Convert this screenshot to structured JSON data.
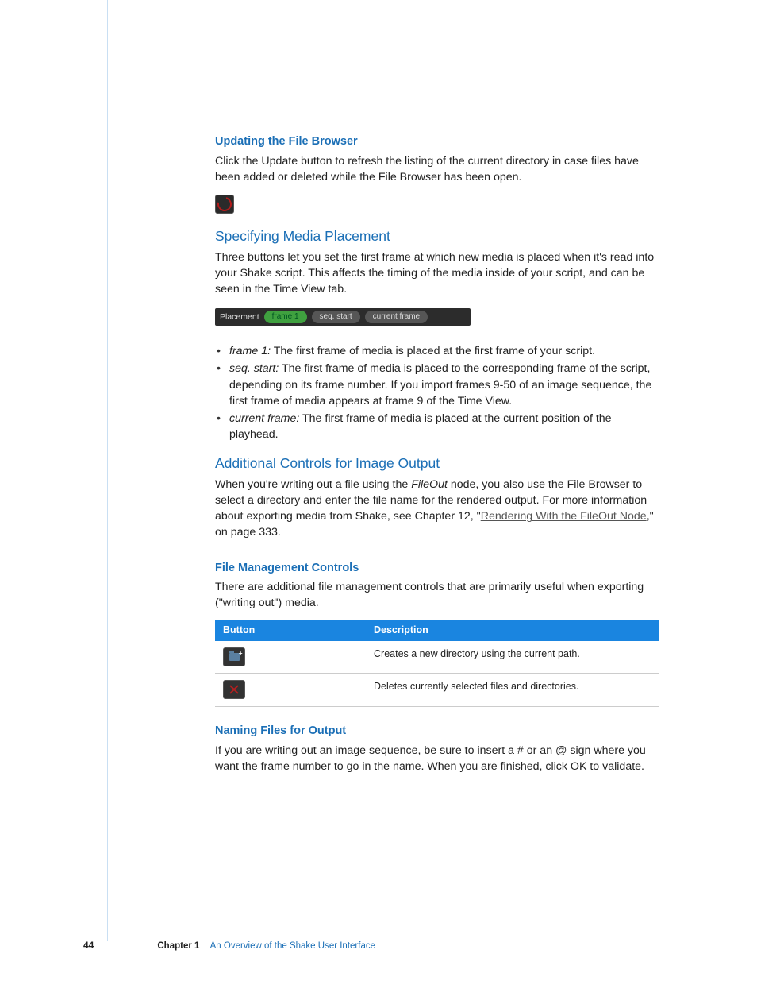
{
  "sections": {
    "updating": {
      "heading": "Updating the File Browser",
      "body": "Click the Update button to refresh the listing of the current directory in case files have been added or deleted while the File Browser has been open."
    },
    "placement": {
      "heading": "Specifying Media Placement",
      "body": "Three buttons let you set the first frame at which new media is placed when it's read into your Shake script. This affects the timing of the media inside of your script, and can be seen in the Time View tab.",
      "bar_label": "Placement",
      "buttons": {
        "frame1": "frame 1",
        "seqstart": "seq. start",
        "current": "current frame"
      },
      "bullets": {
        "frame1_term": "frame 1:",
        "frame1_text": "  The first frame of media is placed at the first frame of your script.",
        "seq_term": "seq. start:",
        "seq_text": "  The first frame of media is placed to the corresponding frame of the script, depending on its frame number. If you import frames 9-50 of an image sequence, the first frame of media appears at frame 9 of the Time View.",
        "cur_term": "current frame:",
        "cur_text": "  The first frame of media is placed at the current position of the playhead."
      }
    },
    "output": {
      "heading": "Additional Controls for Image Output",
      "body_pre": "When you're writing out a file using the ",
      "body_italic": "FileOut",
      "body_mid": " node, you also use the File Browser to select a directory and enter the file name for the rendered output. For more information about exporting media from Shake, see Chapter 12, \"",
      "link": "Rendering With the FileOut Node",
      "body_post": ",\" on page 333."
    },
    "filemgmt": {
      "heading": "File Management Controls",
      "body": "There are additional file management controls that are primarily useful when exporting (\"writing out\") media.",
      "table": {
        "col_button": "Button",
        "col_desc": "Description",
        "row1": "Creates a new directory using the current path.",
        "row2": "Deletes currently selected files and directories."
      }
    },
    "naming": {
      "heading": "Naming Files for Output",
      "body": "If you are writing out an image sequence, be sure to insert a # or an @ sign where you want the frame number to go in the name. When you are finished, click OK to validate."
    }
  },
  "footer": {
    "page_number": "44",
    "chapter_label": "Chapter 1",
    "chapter_title": "An Overview of the Shake User Interface"
  }
}
